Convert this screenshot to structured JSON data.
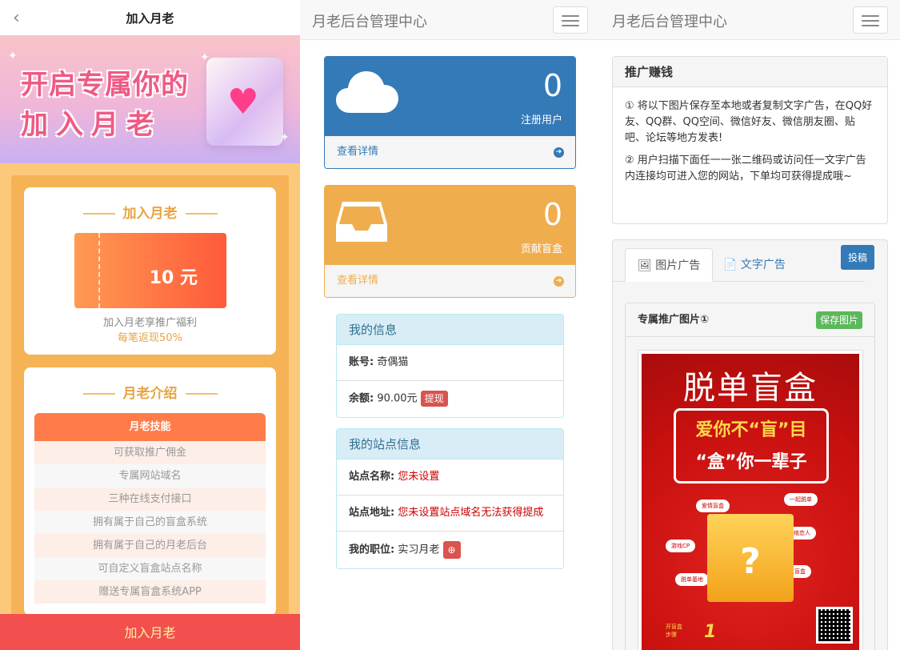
{
  "mobile": {
    "title": "加入月老",
    "banner_line1": "开启专属你的",
    "banner_line2": "加入月老",
    "join_card": {
      "title": "加入月老",
      "coupon_amount": "10 元",
      "desc": "加入月老享推广福利",
      "highlight": "每笔返现50%"
    },
    "intro_card": {
      "title": "月老介绍",
      "skills_header": "月老技能",
      "skills": [
        "可获取推广佣金",
        "专属网站域名",
        "三种在线支付接口",
        "拥有属于自己的盲盒系统",
        "拥有属于自己的月老后台",
        "可自定义盲盒站点名称",
        "赠送专属盲盒系统APP"
      ]
    },
    "join_button": "加入月老"
  },
  "admin": {
    "brand": "月老后台管理中心",
    "stats": [
      {
        "value": "0",
        "label": "注册用户",
        "link": "查看详情"
      },
      {
        "value": "0",
        "label": "贡献盲盒",
        "link": "查看详情"
      }
    ],
    "my_info": {
      "title": "我的信息",
      "account_label": "账号:",
      "account_value": "奇偶猫",
      "balance_label": "余额:",
      "balance_value": "90.00元",
      "withdraw": "提现"
    },
    "site_info": {
      "title": "我的站点信息",
      "name_label": "站点名称:",
      "name_value": "您未设置",
      "addr_label": "站点地址:",
      "addr_value": "您未设置站点域名无法获得提成",
      "role_label": "我的职位:",
      "role_value": "实习月老"
    }
  },
  "promo": {
    "brand": "月老后台管理中心",
    "title": "推广赚钱",
    "p1": "① 将以下图片保存至本地或者复制文字广告，在QQ好友、QQ群、QQ空间、微信好友、微信朋友圈、贴吧、论坛等地方发表!",
    "p2": "② 用户扫描下面任一一张二维码或访问任一文字广告内连接均可进入您的网站，下单均可获得提成哦~",
    "tab_image": "图片广告",
    "tab_text": "文字广告",
    "submit": "投稿",
    "image_title": "专属推广图片①",
    "save": "保存图片",
    "poster": {
      "title": "脱单盲盒",
      "line1": "爱你不“盲”目",
      "line2": "“盒”你一辈子",
      "tags": [
        "爱情盲盒",
        "一起脱单",
        "游戏CP",
        "网络恋人",
        "脱单基地",
        "交友盲盒"
      ],
      "bottom1": "开盲盒",
      "bottom2": "步骤",
      "step": "1"
    }
  }
}
